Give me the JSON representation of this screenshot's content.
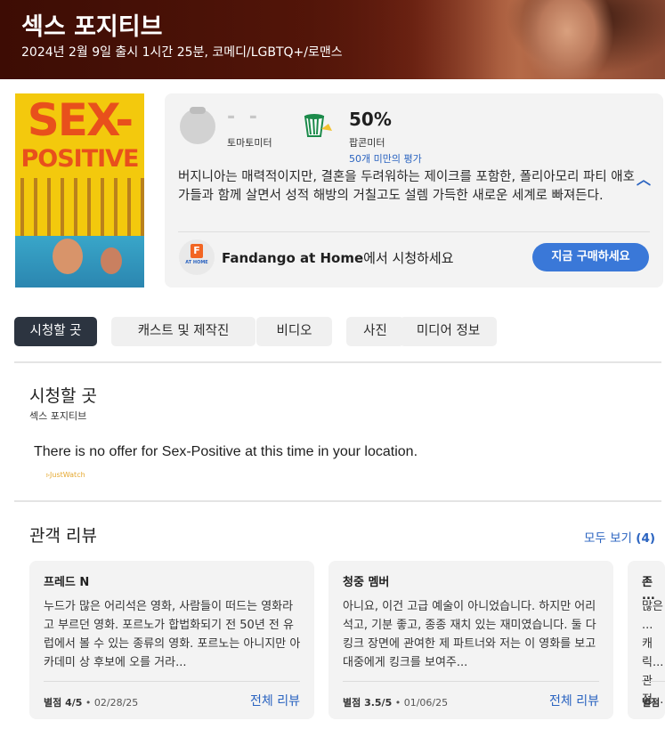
{
  "hero": {
    "title": "섹스 포지티브",
    "meta": "2024년 2월 9일 출시 1시간 25분,  코메디/LGBTQ+/로맨스"
  },
  "poster": {
    "title_line1": "SEX-",
    "title_line2": "POSITIVE"
  },
  "scores": {
    "tomatometer_value": "- -",
    "tomatometer_label": "토마토미터",
    "popcornmeter_value": "50%",
    "popcornmeter_label": "팝콘미터",
    "popcornmeter_count": "50개 미만의 평가",
    "synopsis": "버지니아는 매력적이지만, 결혼을 두려워하는 제이크를 포함한, 폴리아모리 파티 애호가들과 함께 살면서 성적 해방의 거칠고도 설렘 가득한 새로운 세계로 빠져든다.",
    "provider_icon_text": "F",
    "provider_icon_sub": "AT HOME",
    "provider_name": "Fandango at Home",
    "provider_suffix": "에서 시청하세요",
    "buy_label": "지금 구매하세요"
  },
  "tabs": [
    {
      "label": "시청할 곳",
      "active": true
    },
    {
      "label": "캐스트 및 제작진",
      "active": false
    },
    {
      "label": "비디오",
      "active": false
    },
    {
      "label": "사진",
      "active": false
    },
    {
      "label": "미디어 정보",
      "active": false
    }
  ],
  "where_to_watch": {
    "title": "시청할 곳",
    "subtitle": "섹스 포지티브",
    "no_offer": "There is no offer for Sex-Positive at this time in your location.",
    "attribution": "JustWatch"
  },
  "reviews": {
    "title": "관객 리뷰",
    "see_all": "모두 보기",
    "see_all_count": "(4)",
    "items": [
      {
        "name": "프레드 N",
        "text": "누드가 많은 어리석은 영화, 사람들이 떠드는 영화라고 부르던 영화. 포르노가 합법화되기 전 50년 전 유럽에서 볼 수 있는 종류의 영화. 포르노는 아니지만 아카데미 상 후보에 오를 거라...",
        "rating": "별점 4/5",
        "date": "02/28/25",
        "link": "전체 리뷰"
      },
      {
        "name": "청중 멤버",
        "text": "아니요, 이건 고급 예술이 아니었습니다. 하지만 어리석고, 기분 좋고, 종종 재치 있는 재미였습니다. 둘 다 킹크 장면에 관여한 제 파트너와 저는 이 영화를 보고 대중에게 킹크를 보여주...",
        "rating": "별점 3.5/5",
        "date": "01/06/25",
        "link": "전체 리뷰"
      },
      {
        "name": "존 ...",
        "text": "많은 ... 캐릭... 관점...",
        "rating": "별점",
        "date": "",
        "link": ""
      }
    ]
  },
  "colors": {
    "accent_blue": "#3a78d8",
    "link_blue": "#2a63c0",
    "tab_active": "#2c3440",
    "popcorn_green": "#1b8a4a"
  }
}
